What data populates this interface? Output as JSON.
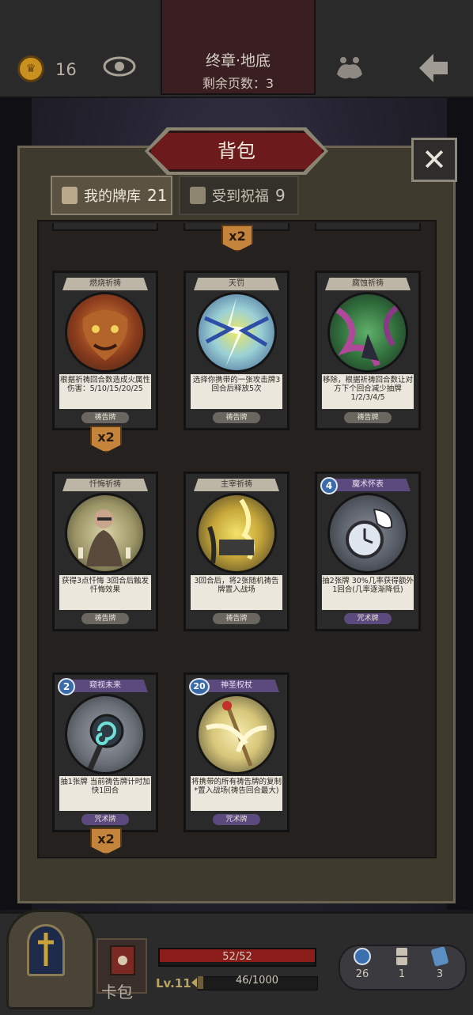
{
  "topbar": {
    "coins": "16",
    "chapter": "终章·地底",
    "pages_left": "剩余页数：3"
  },
  "panel": {
    "title": "背包",
    "close_icon": "x-icon",
    "tabs": [
      {
        "label": "我的牌库",
        "count": "21",
        "icon": "cards-icon",
        "active": true
      },
      {
        "label": "受到祝福",
        "count": "9",
        "icon": "gift-icon",
        "active": false
      }
    ]
  },
  "cards": [
    {
      "name": "燃烧祈祷",
      "desc": "根据祈祷回合数造成火属性伤害：5/10/15/20/25",
      "type": "祷告牌",
      "mult": "x2",
      "kind": "prayer"
    },
    {
      "name": "天罚",
      "desc": "选择你携带的一张攻击牌3回合后释放5次",
      "type": "祷告牌",
      "mult": "",
      "kind": "prayer"
    },
    {
      "name": "腐蚀祈祷",
      "desc": "移除，根据祈祷回合数让对方下个回合减少抽牌1/2/3/4/5",
      "type": "祷告牌",
      "mult": "",
      "kind": "prayer"
    },
    {
      "name": "忏悔祈祷",
      "desc": "获得3点忏悔 3回合后触发忏悔效果",
      "type": "祷告牌",
      "mult": "",
      "kind": "prayer"
    },
    {
      "name": "主宰祈祷",
      "desc": "3回合后，将2张随机祷告牌置入战场",
      "type": "祷告牌",
      "mult": "",
      "kind": "prayer"
    },
    {
      "name": "魔术怀表",
      "desc": "抽2张牌 30%几率获得额外1回合(几率逐渐降低)",
      "type": "咒术牌",
      "mult": "",
      "kind": "magic",
      "cost": "4"
    },
    {
      "name": "窥视未来",
      "desc": "抽1张牌 当前祷告牌计时加快1回合",
      "type": "咒术牌",
      "mult": "x2",
      "kind": "magic",
      "cost": "2"
    },
    {
      "name": "神圣权杖",
      "desc": "将携带的所有祷告牌的复制*置入战场(祷告回合最大)",
      "type": "咒术牌",
      "mult": "",
      "kind": "magic",
      "cost": "20"
    }
  ],
  "top_row_mult": "x2",
  "bottom": {
    "deck_label": "卡包",
    "hp": "52/52",
    "hp_fraction": 1.0,
    "level": "Lv.11",
    "xp": "46/1000",
    "xp_fraction": 0.046,
    "stats": [
      {
        "icon": "potion-icon",
        "value": "26"
      },
      {
        "icon": "hourglass-icon",
        "value": "1"
      },
      {
        "icon": "card-stack-icon",
        "value": "3"
      }
    ]
  },
  "colors": {
    "accent_red": "#6d1a1d",
    "gold": "#c8901e",
    "magic_purple": "#5c4a7e"
  }
}
